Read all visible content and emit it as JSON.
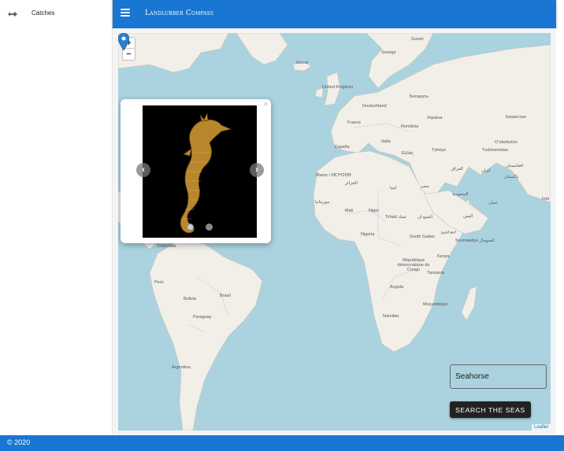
{
  "app": {
    "title": "Landlubber Compass"
  },
  "sidebar": {
    "items": [
      {
        "label": "Catches",
        "icon": "fish-icon"
      }
    ]
  },
  "map": {
    "zoom_in": "+",
    "zoom_out": "−",
    "attribution": "Leaflet",
    "labels": {
      "suomi": "Suomi",
      "sverige": "Sverige",
      "island": "Ísland",
      "uk": "United Kingdom",
      "deutschland": "Deutschland",
      "belarus": "Беларусь",
      "ukraine": "Україна",
      "kazakhstan": "Казахстан",
      "france": "France",
      "romania": "România",
      "ozbekiston": "O‘zbekiston",
      "turkmenistan": "Turkmenistan",
      "italia": "Italia",
      "espana": "España",
      "ellas": "Ελλάς",
      "turkiye": "Türkiye",
      "iraq": "العراق",
      "iran": "ایران",
      "afghanistan": "افغانستان",
      "pakistan": "پاکستان",
      "india": "Indi",
      "maroc": "Maroc / ⵍⵎⵖⵔⵉⴱ",
      "algeria": "الجزائر",
      "libya": "ليبيا",
      "egypt": "مصر",
      "saudi": "السعودية",
      "oman": "عمان",
      "mauritanie": "موريتانيا",
      "mali": "Mali",
      "niger": "Niger",
      "tchad": "Tchad تشاد",
      "sudan": "السودان",
      "yemen": "اليمن",
      "ethiopia": "ኢትዮጵያ",
      "somaliland": "Soomaaliya الصومال",
      "nigeria": "Nigeria",
      "south_sudan": "South Sudan",
      "kenya": "Kenya",
      "rdc": "République démocratique du Congo",
      "tanzania": "Tanzania",
      "angola": "Angola",
      "mocambique": "Moçambique",
      "namibia": "Namibia",
      "colombia": "Colombia",
      "peru": "Perú",
      "brasil": "Brasil",
      "bolivia": "Bolivia",
      "paraguay": "Paraguay",
      "argentina": "Argentina"
    }
  },
  "popup": {
    "close": "×",
    "prev": "‹",
    "next": "›",
    "image_subject": "seahorse-photo",
    "slide_count": 2,
    "active_slide": 1
  },
  "search": {
    "value": "Seahorse",
    "button_label": "SEARCH THE SEAS"
  },
  "footer": {
    "text": "© 2020"
  },
  "colors": {
    "primary": "#1976d2",
    "water": "#aad3df",
    "land": "#f2efe9",
    "button": "#222222"
  }
}
